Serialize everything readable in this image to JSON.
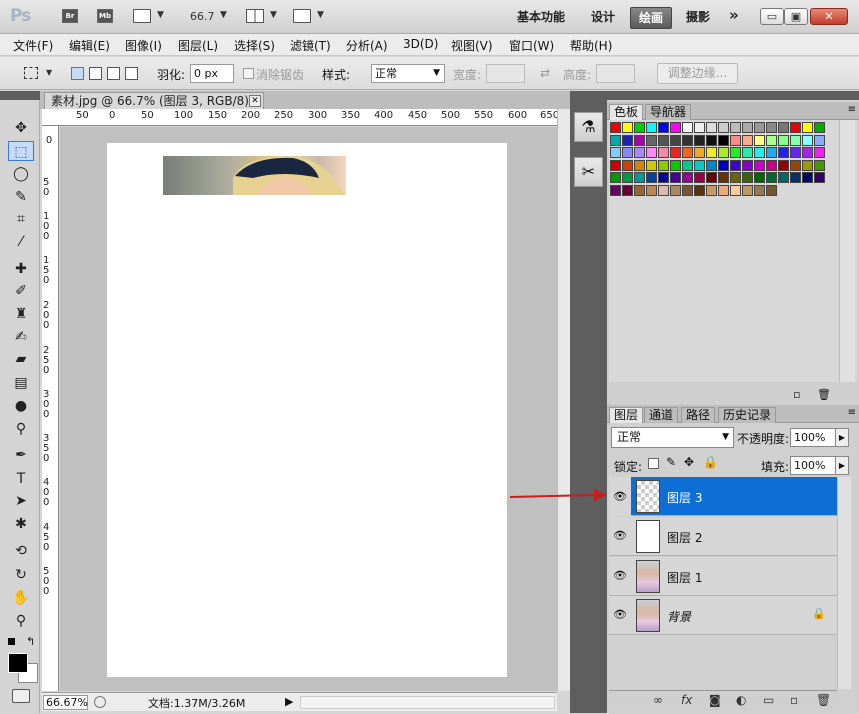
{
  "title_bar": {
    "app_logo": "Ps",
    "bridge_label": "Br",
    "minibridge_label": "Mb",
    "zoom_value": "66.7",
    "workspaces": [
      "基本功能",
      "设计",
      "绘画",
      "摄影"
    ],
    "more": "»",
    "window_minimize": "▭",
    "window_restore": "▣",
    "window_close": "✕"
  },
  "menu": [
    "文件(F)",
    "编辑(E)",
    "图像(I)",
    "图层(L)",
    "选择(S)",
    "滤镜(T)",
    "分析(A)",
    "3D(D)",
    "视图(V)",
    "窗口(W)",
    "帮助(H)"
  ],
  "options": {
    "feather_label": "羽化:",
    "feather_value": "0 px",
    "antialias_label": "消除锯齿",
    "style_label": "样式:",
    "style_value": "正常",
    "width_label": "宽度:",
    "height_label": "高度:",
    "refine_edge": "调整边缘..."
  },
  "document": {
    "tab_title": "素材.jpg @ 66.7% (图层 3, RGB/8) *",
    "ruler_top": [
      "50",
      "0",
      "50",
      "100",
      "150",
      "200",
      "250",
      "300",
      "350",
      "400",
      "450",
      "500",
      "550",
      "600",
      "650"
    ],
    "ruler_left": [
      "0",
      "5 0",
      "1 0 0",
      "1 5 0",
      "2 0 0",
      "2 5 0",
      "3 0 0",
      "3 5 0",
      "4 0 0",
      "4 5 0",
      "5 0 0"
    ]
  },
  "status": {
    "zoom": "66.67%",
    "doc_info": "文档:1.37M/3.26M"
  },
  "swatch_panel": {
    "tabs": [
      "色板",
      "导航器"
    ]
  },
  "layers_panel": {
    "tabs": [
      "图层",
      "通道",
      "路径",
      "历史记录"
    ],
    "blend_mode": "正常",
    "opacity_label": "不透明度:",
    "opacity_value": "100%",
    "lock_label": "锁定:",
    "fill_label": "填充:",
    "fill_value": "100%",
    "layers": [
      {
        "name": "图层 3",
        "selected": true
      },
      {
        "name": "图层 2",
        "selected": false
      },
      {
        "name": "图层 1",
        "selected": false
      },
      {
        "name": "背景",
        "selected": false,
        "locked": true
      }
    ]
  },
  "colors": {
    "accent": "#0d6fd6",
    "annotation_arrow": "#c81e1e"
  }
}
